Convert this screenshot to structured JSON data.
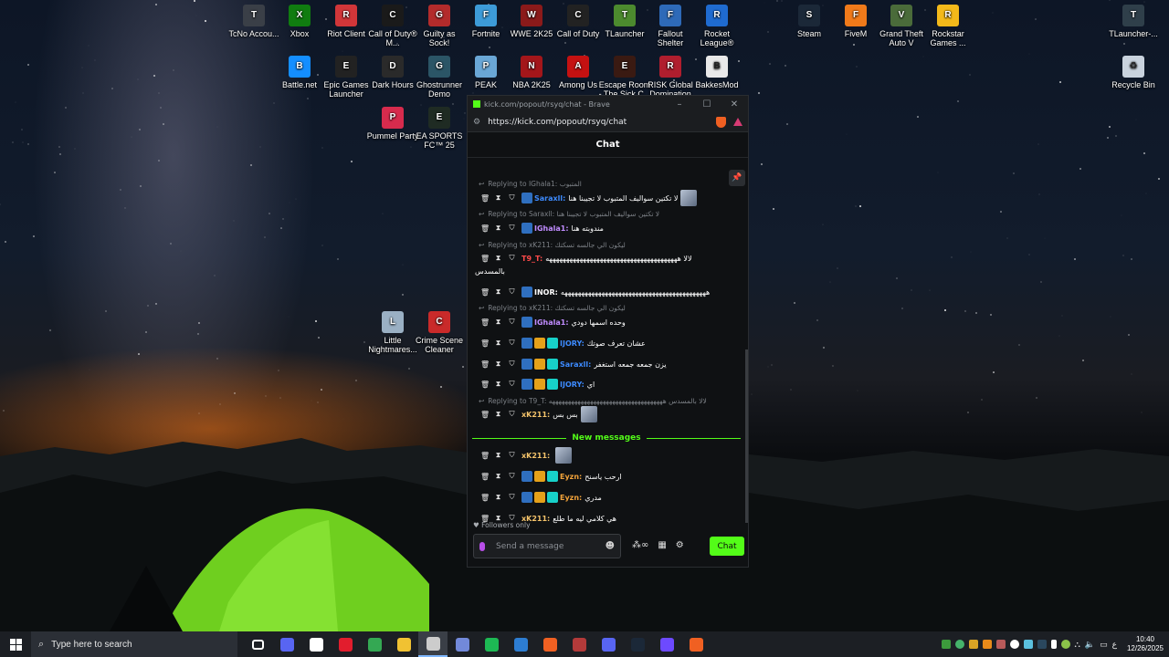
{
  "desktop": {
    "icons": [
      {
        "label": "TcNo Accou...",
        "icon": "tcno-icon",
        "color": "#3a3f47",
        "letter": "T"
      },
      {
        "label": "Xbox",
        "icon": "xbox-icon",
        "color": "#107c10",
        "letter": "X"
      },
      {
        "label": "Riot Client",
        "icon": "riot-icon",
        "color": "#d13639",
        "letter": "R"
      },
      {
        "label": "Call of Duty® M...",
        "icon": "cod-icon",
        "color": "#1a1a1a",
        "letter": "C"
      },
      {
        "label": "Guilty as Sock!",
        "icon": "guilty-as-sock-icon",
        "color": "#b32b2b",
        "letter": "G"
      },
      {
        "label": "Fortnite",
        "icon": "fortnite-icon",
        "color": "#3d9bd8",
        "letter": "F"
      },
      {
        "label": "WWE 2K25",
        "icon": "wwe-icon",
        "color": "#8b1a1a",
        "letter": "W"
      },
      {
        "label": "Call of Duty",
        "icon": "cod-icon",
        "color": "#222222",
        "letter": "C"
      },
      {
        "label": "TLauncher",
        "icon": "tlauncher-icon",
        "color": "#4c8a2e",
        "letter": "T"
      },
      {
        "label": "Fallout Shelter",
        "icon": "fallout-icon",
        "color": "#2e6ab8",
        "letter": "F"
      },
      {
        "label": "Rocket League®",
        "icon": "rocket-league-icon",
        "color": "#1f6bd0",
        "letter": "R"
      },
      {
        "label": "Steam",
        "icon": "steam-icon",
        "color": "#1b2838",
        "letter": "S"
      },
      {
        "label": "FiveM",
        "icon": "fivem-icon",
        "color": "#f07a1a",
        "letter": "F"
      },
      {
        "label": "Grand Theft Auto V",
        "icon": "gta-icon",
        "color": "#4a6b3a",
        "letter": "V"
      },
      {
        "label": "Rockstar Games ...",
        "icon": "rockstar-icon",
        "color": "#f3b91a",
        "letter": "R"
      },
      {
        "label": "TLauncher-...",
        "icon": "tlauncher-icon",
        "color": "#2f3f4a",
        "letter": "T"
      },
      {
        "label": "Battle.net",
        "icon": "battlenet-icon",
        "color": "#148eff",
        "letter": "B"
      },
      {
        "label": "Epic Games Launcher",
        "icon": "epic-icon",
        "color": "#222222",
        "letter": "E"
      },
      {
        "label": "Dark Hours",
        "icon": "dark-hours-icon",
        "color": "#2a2a2a",
        "letter": "D"
      },
      {
        "label": "Ghostrunner Demo",
        "icon": "ghostrunner-icon",
        "color": "#2b5566",
        "letter": "G"
      },
      {
        "label": "PEAK",
        "icon": "peak-icon",
        "color": "#6aa7d6",
        "letter": "P"
      },
      {
        "label": "NBA 2K25",
        "icon": "nba-icon",
        "color": "#a3161a",
        "letter": "N"
      },
      {
        "label": "Among Us",
        "icon": "among-us-icon",
        "color": "#c51111",
        "letter": "A"
      },
      {
        "label": "Escape Room - The Sick C...",
        "icon": "escape-room-icon",
        "color": "#3a1a12",
        "letter": "E"
      },
      {
        "label": "RISK Global Domination",
        "icon": "risk-icon",
        "color": "#b01e2e",
        "letter": "R"
      },
      {
        "label": "BakkesMod",
        "icon": "bakkesmod-icon",
        "color": "#e9e9e9",
        "letter": "B"
      },
      {
        "label": "Recycle Bin",
        "icon": "recycle-bin-icon",
        "color": "#c9d3de",
        "letter": "♻"
      },
      {
        "label": "Pummel Party",
        "icon": "pummel-party-icon",
        "color": "#d72b4d",
        "letter": "P"
      },
      {
        "label": "EA SPORTS FC™ 25",
        "icon": "ea-fc-icon",
        "color": "#1f2b23",
        "letter": "E"
      },
      {
        "label": "Little Nightmares...",
        "icon": "little-nightmares-icon",
        "color": "#9ab0c4",
        "letter": "L"
      },
      {
        "label": "Crime Scene Cleaner",
        "icon": "crime-scene-cleaner-icon",
        "color": "#c92a2a",
        "letter": "C"
      }
    ]
  },
  "browser": {
    "title": "kick.com/popout/rsyq/chat - Brave",
    "url": "https://kick.com/popout/rsyq/chat",
    "controls": {
      "minimize": "–",
      "maximize": "☐",
      "close": "✕"
    }
  },
  "chat": {
    "header": "Chat",
    "new_messages_label": "New messages",
    "followers_only": "Followers only",
    "input_placeholder": "Send a message",
    "send_label": "Chat",
    "messages": [
      {
        "type": "reply",
        "text": "Replying to IGhala1: المتبوب"
      },
      {
        "type": "msg",
        "badges": [
          "blue"
        ],
        "user": "Saraxll",
        "color": "#3d8bff",
        "text": "لا تكتين سواليف المتبوب لا تجيبنا هنا",
        "avatar": true
      },
      {
        "type": "reply",
        "text": "Replying to Saraxll: لا تكتين سواليف المتبوب لا تجيبنا هنا"
      },
      {
        "type": "msg",
        "badges": [
          "blue"
        ],
        "user": "IGhala1",
        "color": "#c08cff",
        "text": "مندوبته هنا"
      },
      {
        "type": "reply",
        "text": "Replying to xK211: ليكون الي جالسه تسكتك"
      },
      {
        "type": "msg",
        "badges": [],
        "user": "T9_T",
        "color": "#ff4b4b",
        "text": "لالا هههههههههههههههههههههههههههههههههههههههه"
      },
      {
        "type": "cont",
        "text": "بالمسدس"
      },
      {
        "type": "msg",
        "badges": [
          "blue"
        ],
        "user": "INOR",
        "color": "#ffffff",
        "text": "هههههههههههههههههههههههههههههههههههههههههههه"
      },
      {
        "type": "reply",
        "text": "Replying to xK211: ليكون الي جالسه تسكتك"
      },
      {
        "type": "msg",
        "badges": [
          "blue"
        ],
        "user": "IGhala1",
        "color": "#c08cff",
        "text": "وحده اسمها دودي"
      },
      {
        "type": "msg",
        "badges": [
          "blue",
          "gold",
          "cyan"
        ],
        "user": "IJORY",
        "color": "#3d8bff",
        "text": "عشان تعرف صوتك"
      },
      {
        "type": "msg",
        "badges": [
          "blue",
          "gold",
          "cyan"
        ],
        "user": "Saraxll",
        "color": "#3d8bff",
        "text": "يزن جمعه جمعه استغفر"
      },
      {
        "type": "msg",
        "badges": [
          "blue",
          "gold",
          "cyan"
        ],
        "user": "IJORY",
        "color": "#3d8bff",
        "text": "اي"
      },
      {
        "type": "reply",
        "text": "Replying to T9_T: لالا بالمسدس ههههههههههههههههههههههههههههههههههههه"
      },
      {
        "type": "msg",
        "badges": [],
        "user": "xK211",
        "color": "#f5c46b",
        "text": "بس بس",
        "avatar": true
      },
      {
        "type": "msg",
        "badges": [],
        "user": "xK211",
        "color": "#f5c46b",
        "text": "",
        "avatar": true
      },
      {
        "type": "msg",
        "badges": [
          "blue",
          "gold",
          "cyan"
        ],
        "user": "Eyzn",
        "color": "#f2a33a",
        "text": "ارحب ياسنح"
      },
      {
        "type": "msg",
        "badges": [
          "blue",
          "gold",
          "cyan"
        ],
        "user": "Eyzn",
        "color": "#f2a33a",
        "text": "مدري"
      },
      {
        "type": "msg",
        "badges": [],
        "user": "xK211",
        "color": "#f5c46b",
        "text": "هي كلامي ليه ما طلع"
      }
    ]
  },
  "taskbar": {
    "search_placeholder": "Type here to search",
    "time": "10:40",
    "date": "12/26/2025",
    "language": "ع",
    "apps": [
      {
        "icon": "task-view-icon",
        "color": "#ffffff"
      },
      {
        "icon": "controller-icon",
        "color": "#5865f2"
      },
      {
        "icon": "obs-icon",
        "color": "#ffffff"
      },
      {
        "icon": "opera-icon",
        "color": "#e21d2d"
      },
      {
        "icon": "chrome-icon",
        "color": "#34a853"
      },
      {
        "icon": "file-explorer-icon",
        "color": "#f1c232"
      },
      {
        "icon": "obs-active-icon",
        "color": "#cccccc"
      },
      {
        "icon": "discord-ptb-icon",
        "color": "#7289da"
      },
      {
        "icon": "spotify-icon",
        "color": "#1db954"
      },
      {
        "icon": "app-icon",
        "color": "#2d7dd2"
      },
      {
        "icon": "brave-icon",
        "color": "#f06022"
      },
      {
        "icon": "game-icon",
        "color": "#b33a3a"
      },
      {
        "icon": "discord-icon",
        "color": "#5865f2"
      },
      {
        "icon": "steam-icon",
        "color": "#1b2838"
      },
      {
        "icon": "proton-icon",
        "color": "#6d4aff"
      },
      {
        "icon": "brave-browser-icon",
        "color": "#f06022"
      }
    ]
  }
}
